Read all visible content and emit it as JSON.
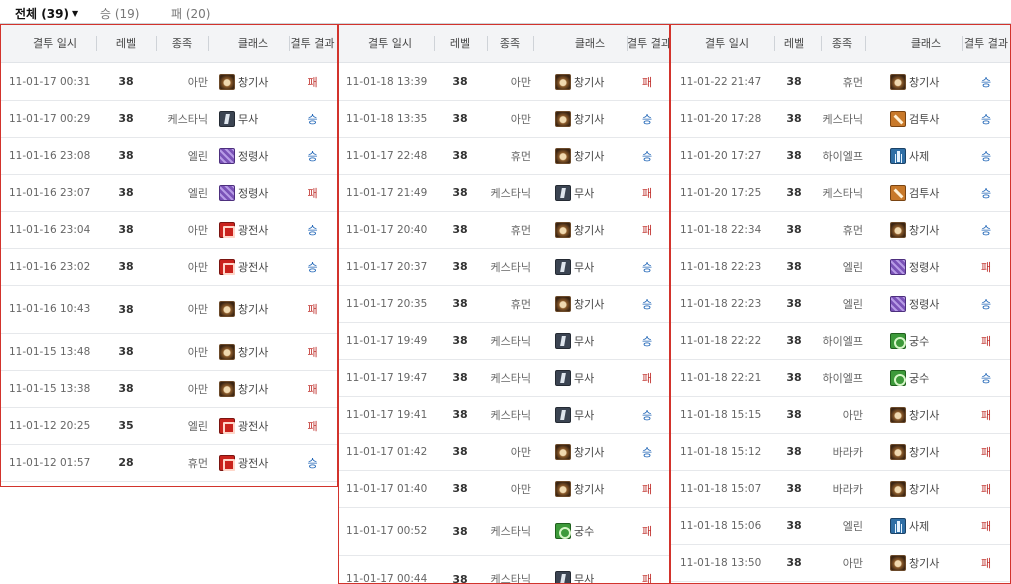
{
  "tabs": {
    "all_label": "전체 (39)",
    "win_label": "승 (19)",
    "lose_label": "패 (20)"
  },
  "headers": {
    "date": "결투 일시",
    "level": "레벨",
    "race": "종족",
    "class": "클래스",
    "result": "결투 결과"
  },
  "icons": {
    "창기사": "spear-knight-icon",
    "무사": "warrior-icon",
    "정령사": "spirit-icon",
    "광전사": "berserker-icon",
    "검투사": "gladiator-icon",
    "사제": "priest-icon",
    "궁수": "archer-icon"
  },
  "colors": {
    "win": "#1b62b5",
    "lose": "#c0322e",
    "panel_border": "#d2332c"
  },
  "panels": [
    {
      "rows": [
        {
          "date": "11-01-17 00:31",
          "level": "38",
          "race": "아만",
          "class": "창기사",
          "result": "패"
        },
        {
          "date": "11-01-17 00:29",
          "level": "38",
          "race": "케스타닉",
          "class": "무사",
          "result": "승"
        },
        {
          "date": "11-01-16 23:08",
          "level": "38",
          "race": "엘린",
          "class": "정령사",
          "result": "승"
        },
        {
          "date": "11-01-16 23:07",
          "level": "38",
          "race": "엘린",
          "class": "정령사",
          "result": "패"
        },
        {
          "date": "11-01-16 23:04",
          "level": "38",
          "race": "아만",
          "class": "광전사",
          "result": "승"
        },
        {
          "date": "11-01-16 23:02",
          "level": "38",
          "race": "아만",
          "class": "광전사",
          "result": "승"
        },
        {
          "date": "11-01-16 10:43",
          "level": "38",
          "race": "아만",
          "class": "창기사",
          "result": "패"
        },
        {
          "date": "11-01-15 13:48",
          "level": "38",
          "race": "아만",
          "class": "창기사",
          "result": "패"
        },
        {
          "date": "11-01-15 13:38",
          "level": "38",
          "race": "아만",
          "class": "창기사",
          "result": "패"
        },
        {
          "date": "11-01-12 20:25",
          "level": "35",
          "race": "엘린",
          "class": "광전사",
          "result": "패"
        },
        {
          "date": "11-01-12 01:57",
          "level": "28",
          "race": "휴먼",
          "class": "광전사",
          "result": "승"
        }
      ]
    },
    {
      "rows": [
        {
          "date": "11-01-18 13:39",
          "level": "38",
          "race": "아만",
          "class": "창기사",
          "result": "패"
        },
        {
          "date": "11-01-18 13:35",
          "level": "38",
          "race": "아만",
          "class": "창기사",
          "result": "승"
        },
        {
          "date": "11-01-17 22:48",
          "level": "38",
          "race": "휴먼",
          "class": "창기사",
          "result": "승"
        },
        {
          "date": "11-01-17 21:49",
          "level": "38",
          "race": "케스타닉",
          "class": "무사",
          "result": "패"
        },
        {
          "date": "11-01-17 20:40",
          "level": "38",
          "race": "휴먼",
          "class": "창기사",
          "result": "패"
        },
        {
          "date": "11-01-17 20:37",
          "level": "38",
          "race": "케스타닉",
          "class": "무사",
          "result": "승"
        },
        {
          "date": "11-01-17 20:35",
          "level": "38",
          "race": "휴먼",
          "class": "창기사",
          "result": "승"
        },
        {
          "date": "11-01-17 19:49",
          "level": "38",
          "race": "케스타닉",
          "class": "무사",
          "result": "승"
        },
        {
          "date": "11-01-17 19:47",
          "level": "38",
          "race": "케스타닉",
          "class": "무사",
          "result": "패"
        },
        {
          "date": "11-01-17 19:41",
          "level": "38",
          "race": "케스타닉",
          "class": "무사",
          "result": "승"
        },
        {
          "date": "11-01-17 01:42",
          "level": "38",
          "race": "아만",
          "class": "창기사",
          "result": "승"
        },
        {
          "date": "11-01-17 01:40",
          "level": "38",
          "race": "아만",
          "class": "창기사",
          "result": "패"
        },
        {
          "date": "11-01-17 00:52",
          "level": "38",
          "race": "케스타닉",
          "class": "궁수",
          "result": "패"
        },
        {
          "date": "11-01-17 00:44",
          "level": "38",
          "race": "케스타닉",
          "class": "무사",
          "result": "패"
        }
      ]
    },
    {
      "rows": [
        {
          "date": "11-01-22 21:47",
          "level": "38",
          "race": "휴먼",
          "class": "창기사",
          "result": "승"
        },
        {
          "date": "11-01-20 17:28",
          "level": "38",
          "race": "케스타닉",
          "class": "검투사",
          "result": "승"
        },
        {
          "date": "11-01-20 17:27",
          "level": "38",
          "race": "하이엘프",
          "class": "사제",
          "result": "승"
        },
        {
          "date": "11-01-20 17:25",
          "level": "38",
          "race": "케스타닉",
          "class": "검투사",
          "result": "승"
        },
        {
          "date": "11-01-18 22:34",
          "level": "38",
          "race": "휴먼",
          "class": "창기사",
          "result": "승"
        },
        {
          "date": "11-01-18 22:23",
          "level": "38",
          "race": "엘린",
          "class": "정령사",
          "result": "패"
        },
        {
          "date": "11-01-18 22:23",
          "level": "38",
          "race": "엘린",
          "class": "정령사",
          "result": "승"
        },
        {
          "date": "11-01-18 22:22",
          "level": "38",
          "race": "하이엘프",
          "class": "궁수",
          "result": "패"
        },
        {
          "date": "11-01-18 22:21",
          "level": "38",
          "race": "하이엘프",
          "class": "궁수",
          "result": "승"
        },
        {
          "date": "11-01-18 15:15",
          "level": "38",
          "race": "아만",
          "class": "창기사",
          "result": "패"
        },
        {
          "date": "11-01-18 15:12",
          "level": "38",
          "race": "바라카",
          "class": "창기사",
          "result": "패"
        },
        {
          "date": "11-01-18 15:07",
          "level": "38",
          "race": "바라카",
          "class": "창기사",
          "result": "패"
        },
        {
          "date": "11-01-18 15:06",
          "level": "38",
          "race": "엘린",
          "class": "사제",
          "result": "패"
        },
        {
          "date": "11-01-18 13:50",
          "level": "38",
          "race": "아만",
          "class": "창기사",
          "result": "패"
        }
      ]
    }
  ]
}
